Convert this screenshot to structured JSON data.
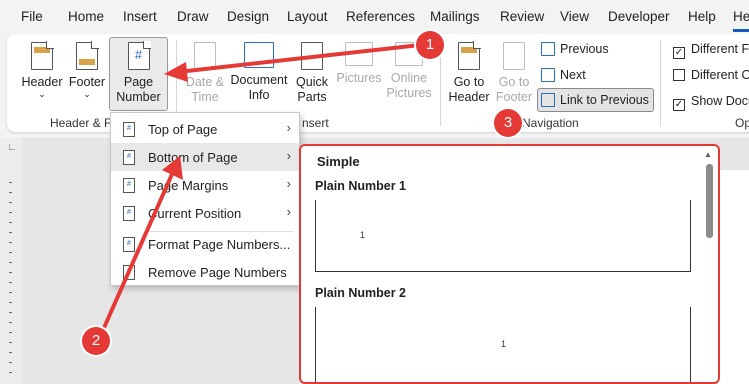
{
  "menu": [
    "File",
    "Home",
    "Insert",
    "Draw",
    "Design",
    "Layout",
    "References",
    "Mailings",
    "Review",
    "View",
    "Developer",
    "Help",
    "He"
  ],
  "ribbon": {
    "header": {
      "label": "Header"
    },
    "footer": {
      "label": "Footer"
    },
    "page_number": {
      "line1": "Page",
      "line2": "Number",
      "glyph": "#"
    },
    "group_header_footer": "Header & F",
    "date_time": {
      "line1": "Date &",
      "line2": "Time"
    },
    "document_info": {
      "line1": "Document",
      "line2": "Info"
    },
    "quick_parts": {
      "line1": "Quick",
      "line2": "Parts"
    },
    "pictures": {
      "label": "Pictures"
    },
    "online_pictures": {
      "line1": "Online",
      "line2": "Pictures"
    },
    "group_insert": "nsert",
    "goto_header": {
      "line1": "Go to",
      "line2": "Header"
    },
    "goto_footer": {
      "line1": "Go to",
      "line2": "Footer"
    },
    "previous": "Previous",
    "next": "Next",
    "link_to_previous": "Link to Previous",
    "group_navigation": "Navigation",
    "options": {
      "different_first": "Different Fi",
      "different_odd": "Different O",
      "show_document": "Show Docu",
      "group_label": "Op",
      "checked": [
        true,
        false,
        true
      ]
    }
  },
  "dropdown": {
    "items": [
      {
        "label": "Top of Page",
        "submenu": true
      },
      {
        "label": "Bottom of Page",
        "submenu": true
      },
      {
        "label": "Page Margins",
        "submenu": true
      },
      {
        "label": "Current Position",
        "submenu": true
      },
      {
        "label": "Format Page Numbers...",
        "submenu": false
      },
      {
        "label": "Remove Page Numbers",
        "submenu": false
      }
    ],
    "hovered_index": 1
  },
  "gallery": {
    "heading": "Simple",
    "items": [
      {
        "label": "Plain Number 1",
        "number_glyph": "1"
      },
      {
        "label": "Plain Number 2",
        "number_glyph": "1"
      }
    ]
  },
  "annotations": {
    "badge1": "1",
    "badge2": "2",
    "badge3": "3",
    "color": "#e53935"
  },
  "colors": {
    "accent": "#185abd",
    "annotation": "#e53935"
  }
}
